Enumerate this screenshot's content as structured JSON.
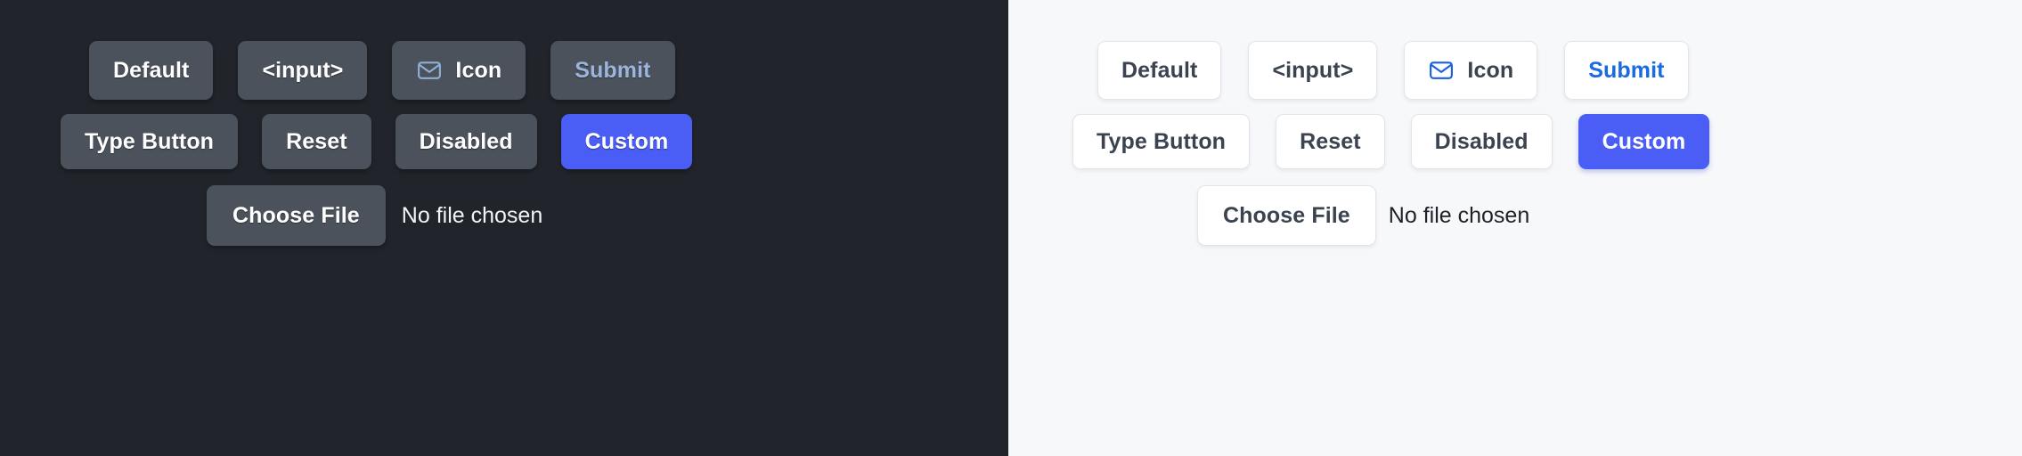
{
  "panels": [
    {
      "theme": "dark",
      "background": "#21252b",
      "surface": "#4b525b",
      "text": "#ffffff",
      "accent": "#4a5ef5",
      "submit_text_color": "#9bb4dd",
      "icon_color": "#8fb0d6",
      "rows": [
        {
          "buttons": [
            {
              "label": "Default",
              "name": "default-button",
              "variant": "default",
              "icon": null
            },
            {
              "label": "<input>",
              "name": "input-button",
              "variant": "default",
              "icon": null
            },
            {
              "label": "Icon",
              "name": "icon-button",
              "variant": "default",
              "icon": "mail-icon"
            },
            {
              "label": "Submit",
              "name": "submit-button",
              "variant": "submit",
              "icon": null
            }
          ]
        },
        {
          "buttons": [
            {
              "label": "Type Button",
              "name": "type-button",
              "variant": "default",
              "icon": null
            },
            {
              "label": "Reset",
              "name": "reset-button",
              "variant": "default",
              "icon": null
            },
            {
              "label": "Disabled",
              "name": "disabled-button",
              "variant": "disabled",
              "icon": null
            },
            {
              "label": "Custom",
              "name": "custom-button",
              "variant": "custom",
              "icon": null
            }
          ]
        }
      ],
      "file_input": {
        "button_label": "Choose File",
        "status_text": "No file chosen"
      }
    },
    {
      "theme": "light",
      "background": "#f7f8fa",
      "surface": "#ffffff",
      "text": "#3b4351",
      "accent": "#4a5ef5",
      "submit_text_color": "#1a6ae0",
      "icon_color": "#1a5fe0",
      "rows": [
        {
          "buttons": [
            {
              "label": "Default",
              "name": "default-button",
              "variant": "default",
              "icon": null
            },
            {
              "label": "<input>",
              "name": "input-button",
              "variant": "default",
              "icon": null
            },
            {
              "label": "Icon",
              "name": "icon-button",
              "variant": "default",
              "icon": "mail-icon"
            },
            {
              "label": "Submit",
              "name": "submit-button",
              "variant": "submit",
              "icon": null
            }
          ]
        },
        {
          "buttons": [
            {
              "label": "Type Button",
              "name": "type-button",
              "variant": "default",
              "icon": null
            },
            {
              "label": "Reset",
              "name": "reset-button",
              "variant": "default",
              "icon": null
            },
            {
              "label": "Disabled",
              "name": "disabled-button",
              "variant": "disabled",
              "icon": null
            },
            {
              "label": "Custom",
              "name": "custom-button",
              "variant": "custom",
              "icon": null
            }
          ]
        }
      ],
      "file_input": {
        "button_label": "Choose File",
        "status_text": "No file chosen"
      }
    }
  ]
}
